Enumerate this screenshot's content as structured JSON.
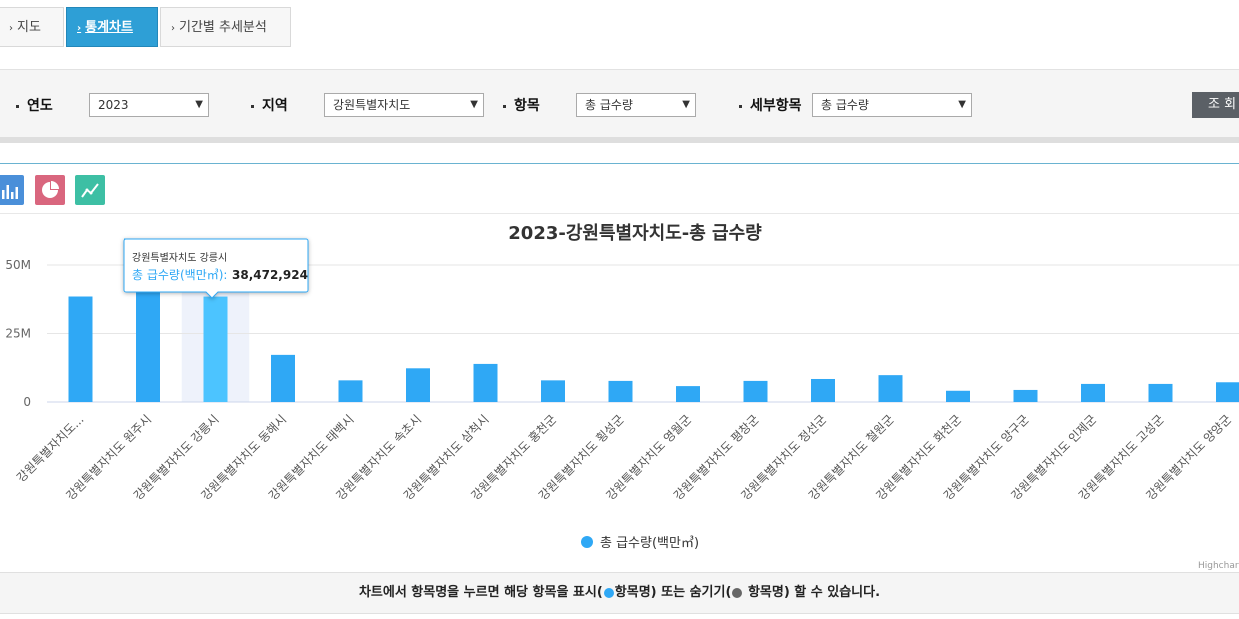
{
  "tabs": [
    {
      "label": "지도",
      "active": false
    },
    {
      "label": "통계차트",
      "active": true
    },
    {
      "label": "기간별 추세분석",
      "active": false
    }
  ],
  "filters": {
    "year": {
      "label": "연도",
      "value": "2023"
    },
    "region": {
      "label": "지역",
      "value": "강원특별자치도"
    },
    "item": {
      "label": "항목",
      "value": "총 급수량"
    },
    "subitem": {
      "label": "세부항목",
      "value": "총 급수량"
    },
    "search_button": "조 회"
  },
  "chart_type_icons": [
    "bar-chart-icon",
    "pie-chart-icon",
    "line-chart-icon"
  ],
  "tooltip": {
    "title": "강원특별자치도 강릉시",
    "series_label": "총 급수량(백만㎥):",
    "value": "38,472,924"
  },
  "credit": "Highcharts.com",
  "footer": {
    "text_a": "차트에서 항목명을 누르면 해당 항목을 표시(",
    "text_b": "항목명) 또는 숨기기(",
    "text_c": " 항목명) 할 수 있습니다."
  },
  "chart_data": {
    "type": "bar",
    "title": "2023-강원특별자치도-총 급수량",
    "ylim": [
      0,
      50000000
    ],
    "yticks": [
      "0",
      "25M",
      "50M"
    ],
    "categories": [
      "강원특별자치도...",
      "강원특별자치도 원주시",
      "강원특별자치도 강릉시",
      "강원특별자치도 동해시",
      "강원특별자치도 태백시",
      "강원특별자치도 속초시",
      "강원특별자치도 삼척시",
      "강원특별자치도 홍천군",
      "강원특별자치도 횡성군",
      "강원특별자치도 영월군",
      "강원특별자치도 평창군",
      "강원특별자치도 정선군",
      "강원특별자치도 철원군",
      "강원특별자치도 화천군",
      "강원특별자치도 양구군",
      "강원특별자치도 인제군",
      "강원특별자치도 고성군",
      "강원특별자치도 양양군"
    ],
    "series": [
      {
        "name": "총 급수량(백만㎥)",
        "values": [
          38500000,
          52000000,
          38472924,
          17200000,
          7900000,
          12300000,
          13900000,
          7900000,
          7700000,
          5800000,
          7700000,
          8400000,
          9800000,
          4100000,
          4400000,
          6600000,
          6600000,
          7200000
        ]
      }
    ],
    "hover_index": 2,
    "legend_position": "bottom",
    "grid": true,
    "colors": {
      "bar": "#2fa8f5",
      "bar_hover": "#4cc4ff",
      "hover_band": "#eef2fb"
    }
  }
}
